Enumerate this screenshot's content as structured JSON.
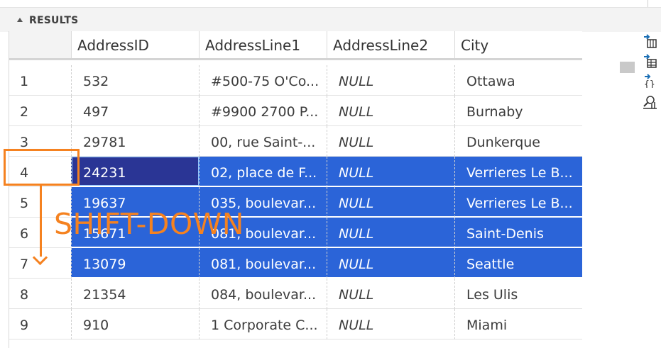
{
  "panel": {
    "title": "RESULTS"
  },
  "columns": [
    "",
    "AddressID",
    "AddressLine1",
    "AddressLine2",
    "City"
  ],
  "rows": [
    {
      "num": "1",
      "AddressID": "532",
      "AddressLine1": "#500-75 O'Co...",
      "AddressLine2": "NULL",
      "City": "Ottawa"
    },
    {
      "num": "2",
      "AddressID": "497",
      "AddressLine1": "#9900 2700 P...",
      "AddressLine2": "NULL",
      "City": "Burnaby"
    },
    {
      "num": "3",
      "AddressID": "29781",
      "AddressLine1": "00, rue Saint-...",
      "AddressLine2": "NULL",
      "City": "Dunkerque"
    },
    {
      "num": "4",
      "AddressID": "24231",
      "AddressLine1": "02, place de F...",
      "AddressLine2": "NULL",
      "City": "Verrieres Le B..."
    },
    {
      "num": "5",
      "AddressID": "19637",
      "AddressLine1": "035, boulevar...",
      "AddressLine2": "NULL",
      "City": "Verrieres Le B..."
    },
    {
      "num": "6",
      "AddressID": "15671",
      "AddressLine1": "081, boulevar...",
      "AddressLine2": "NULL",
      "City": "Saint-Denis"
    },
    {
      "num": "7",
      "AddressID": "13079",
      "AddressLine1": "081, boulevar...",
      "AddressLine2": "NULL",
      "City": "Seattle"
    },
    {
      "num": "8",
      "AddressID": "21354",
      "AddressLine1": "084, boulevar...",
      "AddressLine2": "NULL",
      "City": "Les Ulis"
    },
    {
      "num": "9",
      "AddressID": "910",
      "AddressLine1": "1 Corporate C...",
      "AddressLine2": "NULL",
      "City": "Miami"
    }
  ],
  "selection": {
    "rows": [
      "4",
      "5",
      "6",
      "7"
    ],
    "active_row": "4",
    "color": "#2b64d8",
    "active_color": "#2a3595"
  },
  "annotation": {
    "text": "SHIFT-DOWN",
    "color": "#f58220"
  },
  "side_icons": [
    "export-csv-icon",
    "export-excel-icon",
    "export-json-icon",
    "chart-icon"
  ]
}
